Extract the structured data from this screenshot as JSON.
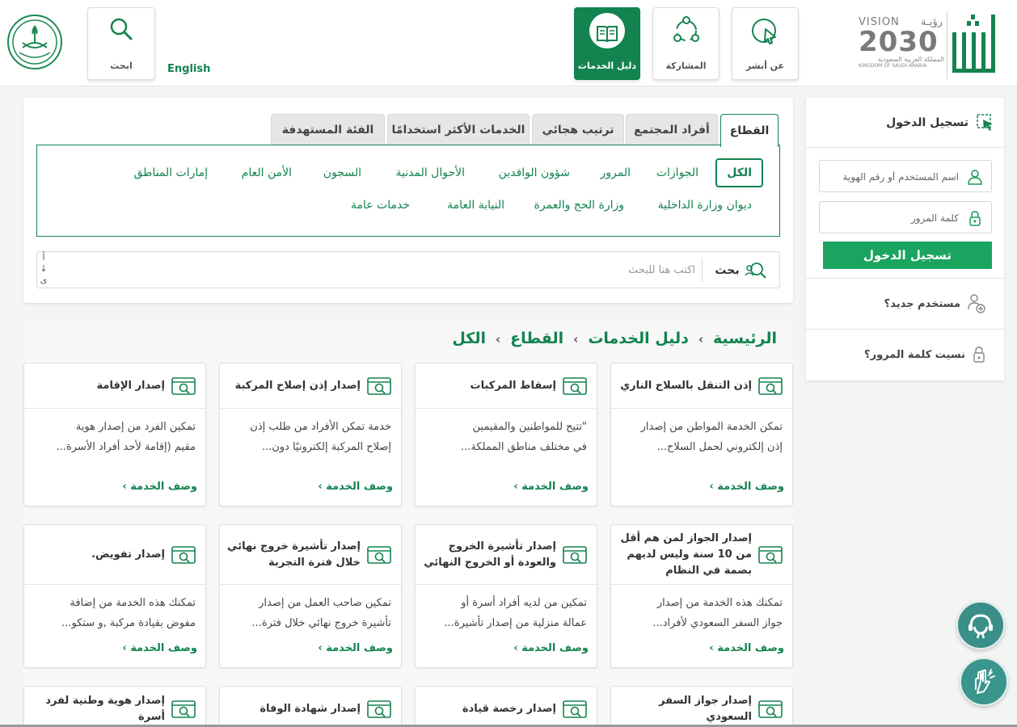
{
  "header": {
    "nav": {
      "about": "عن أبشر",
      "participation": "المشاركة",
      "guide": "دليل الخدمات",
      "search": "ابحث"
    },
    "language_link": "English",
    "vision": {
      "word": "VISION",
      "arabic": "رؤيـة",
      "year": "2030",
      "kingdom_ar": "المملكة العربية السعودية",
      "kingdom_en": "KINGDOM OF SAUDI ARABIA"
    },
    "brand_color": "#13834f"
  },
  "tabs": [
    "القطاع",
    "أفراد المجتمع",
    "ترتيب هجائي",
    "الخدمات الأكثر استخدامًا",
    "الفئة المستهدفة"
  ],
  "categories": {
    "row1": [
      "الكل",
      "الجوازات",
      "المرور",
      "شؤون الوافدين",
      "الأحوال المدنية",
      "السجون",
      "الأمن العام",
      "إمارات المناطق"
    ],
    "row2": [
      "ديوان وزارة الداخلية",
      "وزارة الحج والعمرة",
      "النيابة العامة",
      "خدمات عامة"
    ]
  },
  "search": {
    "placeholder": "اكتب هنا للبحث",
    "button": "بحث",
    "alpha_first": "أ",
    "alpha_arrow": "↓",
    "alpha_last": "ى"
  },
  "breadcrumb": [
    "الرئيسية",
    "دليل الخدمات",
    "القطاع",
    "الكل"
  ],
  "cards": [
    {
      "title": "إذن التنقل بالسلاح الناري",
      "desc1": "تمكن الخدمة المواطن من إصدار",
      "desc2": "إذن إلكتروني لحمل السلاح..."
    },
    {
      "title": "إسقاط المركبات",
      "desc1": "\"تتيح للمواطنين والمقيمين",
      "desc2": "في مختلف مناطق المملكة..."
    },
    {
      "title": "إصدار إذن إصلاح المركبة",
      "desc1": "خدمة تمكن الأفراد من طلب إذن",
      "desc2": "إصلاح المركبة إلكترونيًا دون..."
    },
    {
      "title": "إصدار الإقامة",
      "desc1": "تمكين الفرد من إصدار هوية",
      "desc2": "مقيم (إقامة لأحد أفراد الأسرة..."
    },
    {
      "title": "إصدار الجواز لمن هم أقل من 10 سنة وليس لديهم بصمة في النظام",
      "desc1": "تمكنك هذه الخدمة من إصدار",
      "desc2": "جواز السفر السعودي لأفراد..."
    },
    {
      "title": "إصدار تأشيرة الخروج والعودة أو الخروج النهائي",
      "desc1": "تمكين من لديه أفراد أسرة أو",
      "desc2": "عمالة منزلية من إصدار تأشيرة..."
    },
    {
      "title": "إصدار تأشيرة خروج نهائي خلال فترة التجربة",
      "desc1": "تمكين صاحب العمل من إصدار",
      "desc2": "تأشيرة خروج نهائي خلال فترة..."
    },
    {
      "title": "إصدار تفويض.",
      "desc1": "تمكنك هذه الخدمة من إضافة",
      "desc2": "مفوض بقيادة مركبة ,و ستكو..."
    },
    {
      "title": "إصدار جواز السفر السعودي"
    },
    {
      "title": "إصدار رخصة قيادة"
    },
    {
      "title": "إصدار شهادة الوفاة"
    },
    {
      "title": "إصدار هوية وطنية لفرد أسرة"
    }
  ],
  "card_link": "وصف الخدمة ›",
  "login": {
    "title": "تسجيل الدخول",
    "username_placeholder": "اسم المستخدم أو رقم الهوية",
    "password_placeholder": "كلمة المرور",
    "button": "تسجيل الدخول",
    "new_user": "مستخدم جديد؟",
    "forgot_password": "نسيت كلمة المرور؟"
  }
}
